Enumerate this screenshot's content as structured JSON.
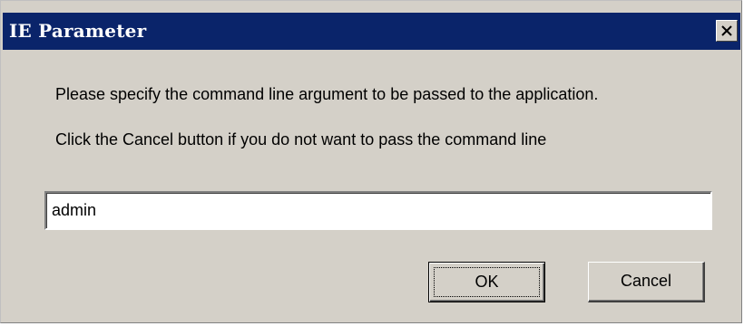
{
  "window": {
    "title": "IE Parameter",
    "close_glyph": "close-icon"
  },
  "message": {
    "line1": "Please specify the command line argument to be passed to the application.",
    "line2": "Click the Cancel button if you do not want to pass the command line"
  },
  "argument_input": {
    "value": "admin"
  },
  "buttons": {
    "ok_label": "OK",
    "cancel_label": "Cancel"
  },
  "colors": {
    "titlebar": "#0a246a",
    "face": "#d4d0c8",
    "title_text": "#ffffff"
  }
}
